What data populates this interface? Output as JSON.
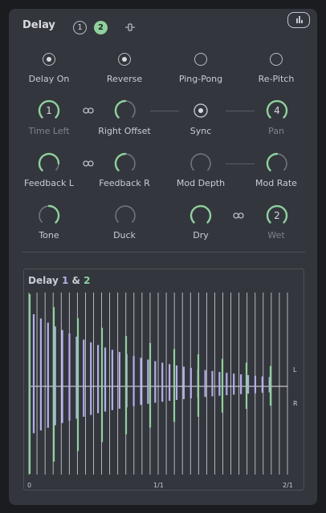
{
  "header": {
    "title": "Delay",
    "tab1": "1",
    "tab2": "2"
  },
  "toggles": [
    {
      "label": "Delay On",
      "on": true
    },
    {
      "label": "Reverse",
      "on": true
    },
    {
      "label": "Ping-Pong",
      "on": false
    },
    {
      "label": "Re-Pitch",
      "on": false
    }
  ],
  "knobs": {
    "time_left": {
      "label": "Time Left",
      "value": "1"
    },
    "right_offset": {
      "label": "Right Offset"
    },
    "sync": {
      "label": "Sync"
    },
    "pan": {
      "label": "Pan",
      "value": "4"
    },
    "feedback_l": {
      "label": "Feedback L"
    },
    "feedback_r": {
      "label": "Feedback R"
    },
    "mod_depth": {
      "label": "Mod Depth"
    },
    "mod_rate": {
      "label": "Mod Rate"
    },
    "tone": {
      "label": "Tone"
    },
    "duck": {
      "label": "Duck"
    },
    "dry": {
      "label": "Dry"
    },
    "wet": {
      "label": "Wet",
      "value": "2"
    }
  },
  "graph": {
    "title_prefix": "Delay",
    "title_a": "1",
    "title_amp": "&",
    "title_b": "2",
    "channel_l": "L",
    "channel_r": "R",
    "x_ticks": [
      "0",
      "1/1",
      "2/1"
    ]
  },
  "colors": {
    "green": "#8fd19e",
    "purple": "#b2afe8",
    "panel": "#34363d"
  }
}
